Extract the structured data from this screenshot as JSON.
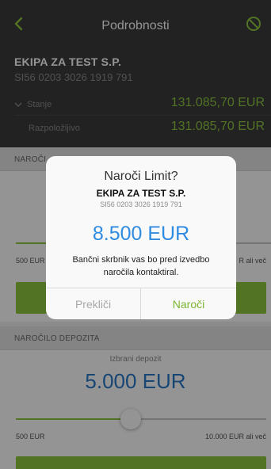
{
  "nav": {
    "title": "Podrobnosti",
    "back_icon": "chevron-left-icon",
    "cancel_icon": "circle-slash-icon"
  },
  "account": {
    "company": "EKIPA ZA TEST S.P.",
    "iban": "SI56 0203 3026 1919 791",
    "stanje_label": "Stanje",
    "stanje_value": "131.085,70 EUR",
    "razpolozljivo_label": "Razpoložljivo",
    "razpolozljivo_value": "131.085,70 EUR"
  },
  "limit_section": {
    "header": "NAROČI",
    "min_label": "500 EUR",
    "max_label": "R ali več",
    "button_label": ""
  },
  "deposit_section": {
    "header": "NAROČILO DEPOZITA",
    "selected_label": "Izbrani depozit",
    "value": "5.000 EUR",
    "min_label": "500 EUR",
    "max_label": "10.000 EUR ali več",
    "slider_fraction": 0.46,
    "button_label": "..."
  },
  "dialog": {
    "title": "Naroči Limit?",
    "company": "EKIPA ZA TEST S.P.",
    "iban": "SI56 0203 3026 1919 791",
    "amount": "8.500 EUR",
    "message": "Bančni skrbnik vas bo pred izvedbo naročila kontaktiral.",
    "cancel_label": "Prekliči",
    "confirm_label": "Naroči"
  },
  "colors": {
    "accent_green": "#8dc63f",
    "value_blue": "#2979c9",
    "header_dark": "#3b3b3d"
  }
}
